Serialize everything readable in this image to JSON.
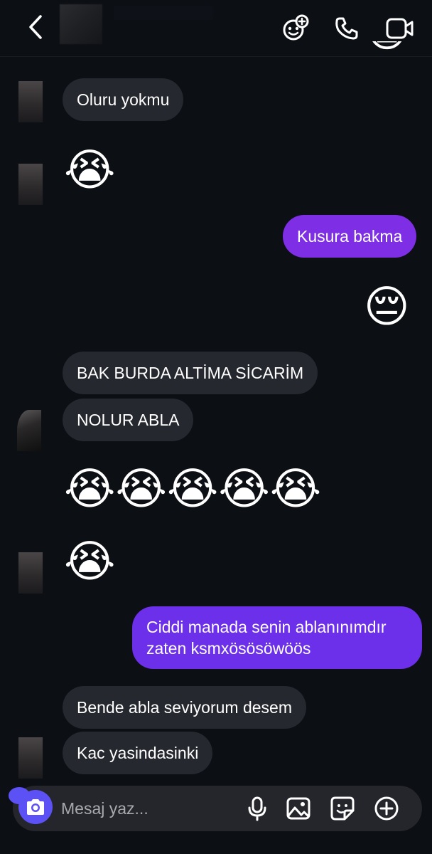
{
  "header": {
    "back_icon": "chevron-left-icon",
    "emoji_icon": "emoji-plus-icon",
    "call_icon": "phone-icon",
    "video_icon": "video-camera-icon"
  },
  "messages": [
    {
      "direction": "in",
      "type": "text",
      "text": "Oluru yokmu"
    },
    {
      "direction": "in",
      "type": "emoji",
      "text": "😭"
    },
    {
      "direction": "out",
      "type": "text",
      "text": "Kusura bakma"
    },
    {
      "direction": "out",
      "type": "emoji",
      "text": "😔"
    },
    {
      "direction": "in",
      "type": "text",
      "text": "BAK BURDA ALTİMA SİCARİM"
    },
    {
      "direction": "in",
      "type": "text",
      "text": "NOLUR ABLA"
    },
    {
      "direction": "in",
      "type": "emoji",
      "text": "😭😭😭😭😭"
    },
    {
      "direction": "in",
      "type": "emoji",
      "text": "😭"
    },
    {
      "direction": "out",
      "type": "text",
      "text": "Ciddi manada senin ablanınımdır zaten ksmxösösöwöös"
    },
    {
      "direction": "in",
      "type": "text",
      "text": "Bende abla seviyorum desem"
    },
    {
      "direction": "in",
      "type": "text",
      "text": "Kac yasindasinki"
    }
  ],
  "peek_emoji": "😭",
  "composer": {
    "placeholder": "Mesaj yaz...",
    "camera_icon": "camera-icon",
    "mic_icon": "microphone-icon",
    "gallery_icon": "image-icon",
    "sticker_icon": "sticker-icon",
    "plus_icon": "plus-circle-icon"
  },
  "colors": {
    "background": "#0c0f14",
    "incoming_bubble": "#262830",
    "outgoing_bubble": "#7e2fe6",
    "camera_button": "#5b51f5"
  }
}
